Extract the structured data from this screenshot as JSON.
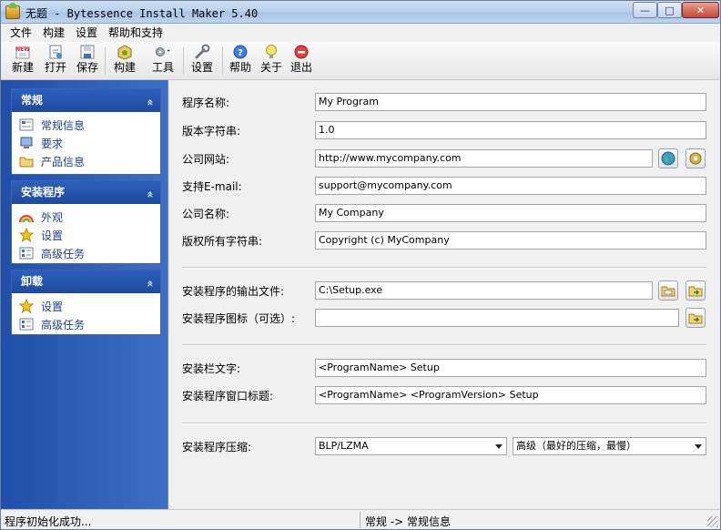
{
  "window": {
    "title": "无题 - Bytessence Install Maker 5.40",
    "minimize": "—",
    "maximize": "□",
    "close": "✕"
  },
  "menu": [
    "文件",
    "构建",
    "设置",
    "帮助和支持"
  ],
  "toolbar": {
    "new": "新建",
    "new_badge": "NEW",
    "open": "打开",
    "save": "保存",
    "build": "构建",
    "tools": "工具",
    "settings": "设置",
    "help": "帮助",
    "about": "关于",
    "exit": "退出"
  },
  "sidebar": {
    "groups": [
      {
        "title": "常规",
        "items": [
          "常规信息",
          "要求",
          "产品信息"
        ]
      },
      {
        "title": "安装程序",
        "items": [
          "外观",
          "设置",
          "高级任务"
        ]
      },
      {
        "title": "卸载",
        "items": [
          "设置",
          "高级任务"
        ]
      }
    ],
    "collapse_glyph": "»"
  },
  "form": {
    "program_name_label": "程序名称:",
    "program_name": "My Program",
    "version_label": "版本字符串:",
    "version": "1.0",
    "website_label": "公司网站:",
    "website": "http://www.mycompany.com",
    "email_label": "支持E-mail:",
    "email": "support@mycompany.com",
    "company_label": "公司名称:",
    "company": "My Company",
    "copyright_label": "版权所有字符串:",
    "copyright": "Copyright (c) MyCompany",
    "output_label": "安装程序的输出文件:",
    "output": "C:\\Setup.exe",
    "icon_label": "安装程序图标（可选）:",
    "icon": "",
    "bar_text_label": "安装栏文字:",
    "bar_text": "<ProgramName> Setup",
    "window_title_label": "安装程序窗口标题:",
    "window_title": "<ProgramName> <ProgramVersion> Setup",
    "compression_label": "安装程序压缩:",
    "compression_method": "BLP/LZMA",
    "compression_level": "高级（最好的压缩，最慢）"
  },
  "status": {
    "left": "程序初始化成功...",
    "right": "常规 -> 常规信息"
  },
  "colors": {
    "sidebar_bg": "#2a5bb5",
    "group_header": "#2556b0",
    "link_text": "#1b3f8a"
  }
}
